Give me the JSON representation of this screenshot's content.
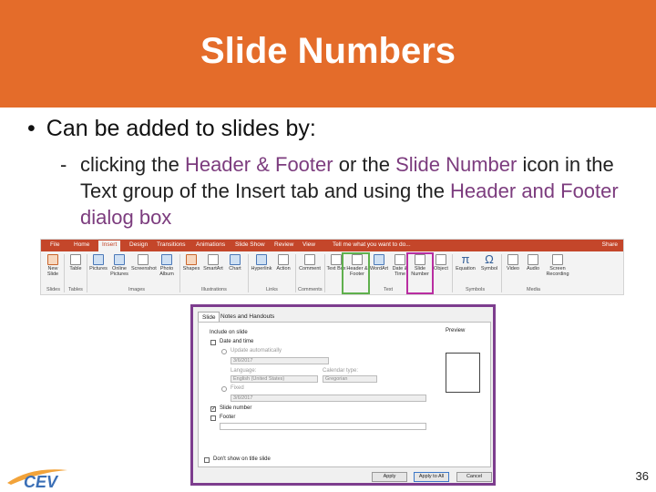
{
  "slide": {
    "title": "Slide Numbers",
    "bullet_marker": "•",
    "bullet": "Can be added to slides by:",
    "sub_dash": "-",
    "sub_text_1": "clicking the ",
    "sub_hl_1": "Header & Footer",
    "sub_text_2": " or the ",
    "sub_hl_2": "Slide Number",
    "sub_text_3": " icon in the Text group of the Insert tab and using the ",
    "sub_hl_3": "Header and Footer dialog box",
    "page_number": "36",
    "logo_text": "CEV",
    "colors": {
      "title_bar": "#e46c2a",
      "highlight": "#7c3c7e",
      "ribbon_tabs": "#c4462a",
      "frame_green": "#5fb04d",
      "frame_purple": "#b92ea1",
      "dialog_border": "#7d3d8e"
    }
  },
  "ribbon": {
    "tabs": [
      "File",
      "Home",
      "Insert",
      "Design",
      "Transitions",
      "Animations",
      "Slide Show",
      "Review",
      "View"
    ],
    "active_tab": "Insert",
    "search": "Tell me what you want to do...",
    "share": "Share",
    "buttons": [
      {
        "label": "New Slide",
        "icon": "new-slide-icon"
      },
      {
        "label": "Table",
        "icon": "table-icon"
      },
      {
        "label": "Pictures",
        "icon": "pictures-icon"
      },
      {
        "label": "Online Pictures",
        "icon": "online-pictures-icon"
      },
      {
        "label": "Screenshot",
        "icon": "screenshot-icon"
      },
      {
        "label": "Photo Album",
        "icon": "photo-album-icon"
      },
      {
        "label": "Shapes",
        "icon": "shapes-icon"
      },
      {
        "label": "SmartArt",
        "icon": "smartart-icon"
      },
      {
        "label": "Chart",
        "icon": "chart-icon"
      },
      {
        "label": "Hyperlink",
        "icon": "hyperlink-icon"
      },
      {
        "label": "Action",
        "icon": "action-icon"
      },
      {
        "label": "Comment",
        "icon": "comment-icon"
      },
      {
        "label": "Text Box",
        "icon": "text-box-icon"
      },
      {
        "label": "Header & Footer",
        "icon": "header-footer-icon"
      },
      {
        "label": "WordArt",
        "icon": "wordart-icon"
      },
      {
        "label": "Date & Time",
        "icon": "date-time-icon"
      },
      {
        "label": "Slide Number",
        "icon": "slide-number-icon"
      },
      {
        "label": "Object",
        "icon": "object-icon"
      },
      {
        "label": "Equation",
        "icon": "equation-icon"
      },
      {
        "label": "Symbol",
        "icon": "symbol-icon"
      },
      {
        "label": "Video",
        "icon": "video-icon"
      },
      {
        "label": "Audio",
        "icon": "audio-icon"
      },
      {
        "label": "Screen Recording",
        "icon": "screen-recording-icon"
      }
    ],
    "groups": [
      "Slides",
      "Tables",
      "Images",
      "Illustrations",
      "Links",
      "Comments",
      "Text",
      "Symbols",
      "Media"
    ]
  },
  "dialog": {
    "tabs": [
      "Slide",
      "Notes and Handouts"
    ],
    "active_tab": "Slide",
    "include_on_slide": "Include on slide",
    "date_and_time": "Date and time",
    "update_automatically": "Update automatically",
    "date_value": "3/6/2017",
    "language_label": "Language:",
    "language_value": "English (United States)",
    "calendar_label": "Calendar type:",
    "calendar_value": "Gregorian",
    "fixed_label": "Fixed",
    "fixed_value": "3/6/2017",
    "slide_number": "Slide number",
    "slide_number_checked": true,
    "footer": "Footer",
    "dont_show": "Don't show on title slide",
    "preview": "Preview",
    "buttons": [
      "Apply",
      "Apply to All",
      "Cancel"
    ]
  }
}
